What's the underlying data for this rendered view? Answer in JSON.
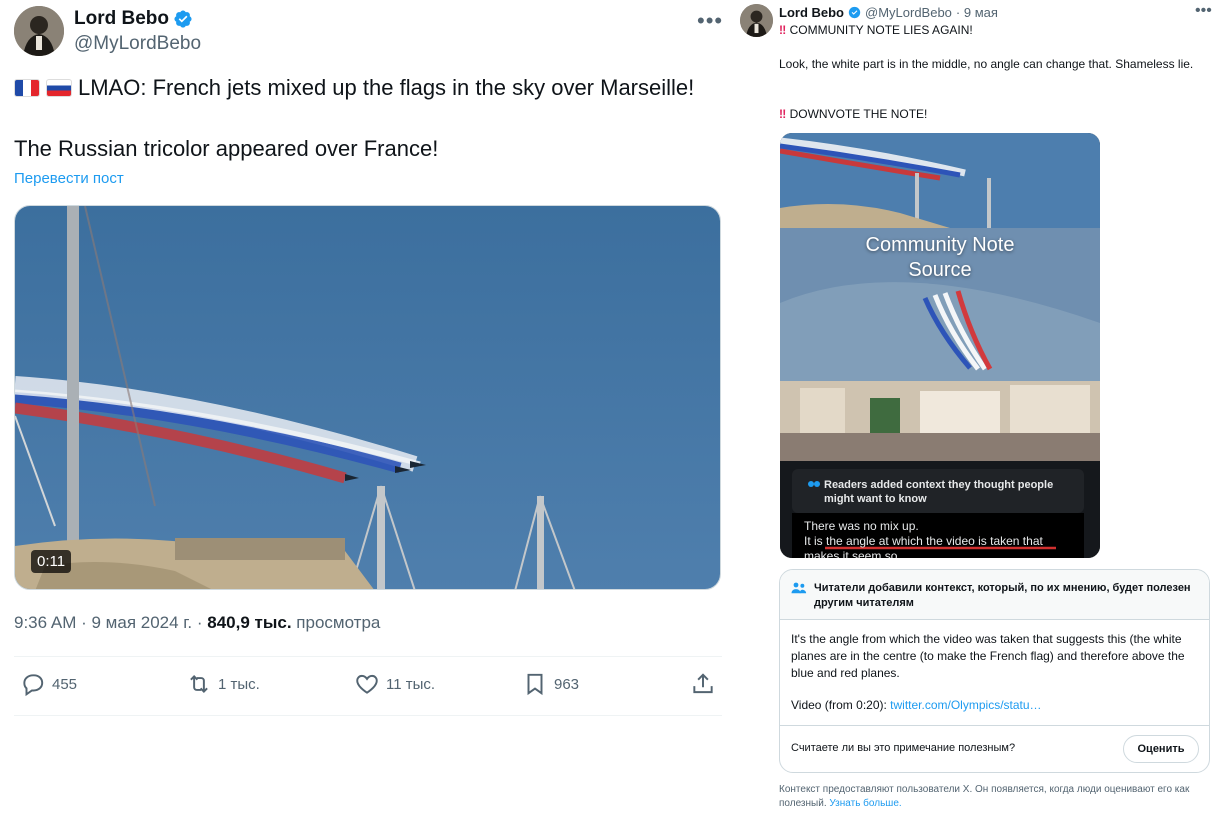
{
  "main_tweet": {
    "author_name": "Lord Bebo",
    "author_handle": "@MyLordBebo",
    "text_line1": "LMAO: French jets mixed up the flags in the sky over Marseille!",
    "text_line2": "The Russian tricolor appeared over France!",
    "translate_label": "Перевести пост",
    "video_duration": "0:11",
    "time": "9:36 AM",
    "date": "9 мая 2024 г.",
    "views_count": "840,9 тыс.",
    "views_label": "просмотра",
    "replies": "455",
    "reposts": "1 тыс.",
    "likes": "11 тыс.",
    "bookmarks": "963"
  },
  "quoted_tweet": {
    "author_name": "Lord Bebo",
    "author_handle": "@MyLordBebo",
    "date": "· 9 мая",
    "line1": "COMMUNITY NOTE LIES AGAIN!",
    "line2": "Look, the white part is in the middle, no angle can change that. Shameless lie.",
    "line3": "DOWNVOTE THE NOTE!",
    "image_overlay_title_1": "Community Note",
    "image_overlay_title_2": "Source",
    "image_note_header": "Readers added context they thought people might want to know",
    "image_note_text_1": "There was no mix up.",
    "image_note_text_2_prefix": "It is ",
    "image_note_text_2_underlined": "the angle at which the video is taken that",
    "image_note_text_3": "makes it seem so"
  },
  "community_note": {
    "header": "Читатели добавили контекст, который, по их мнению, будет полезен другим читателям",
    "body": "It's the angle from which the video was taken that suggests this (the white planes are in the centre (to make the French flag) and therefore above the blue and red planes.",
    "video_label": "Video (from 0:20):",
    "video_link": "twitter.com/Olympics/statu…",
    "question": "Считаете ли вы это примечание полезным?",
    "rate_button": "Оценить",
    "disclaimer": "Контекст предоставляют пользователи X. Он появляется, когда люди оценивают его как полезный.",
    "learn_more": "Узнать больше."
  },
  "colors": {
    "accent": "#1d9bf0",
    "text_primary": "#0f1419",
    "text_secondary": "#536471"
  }
}
